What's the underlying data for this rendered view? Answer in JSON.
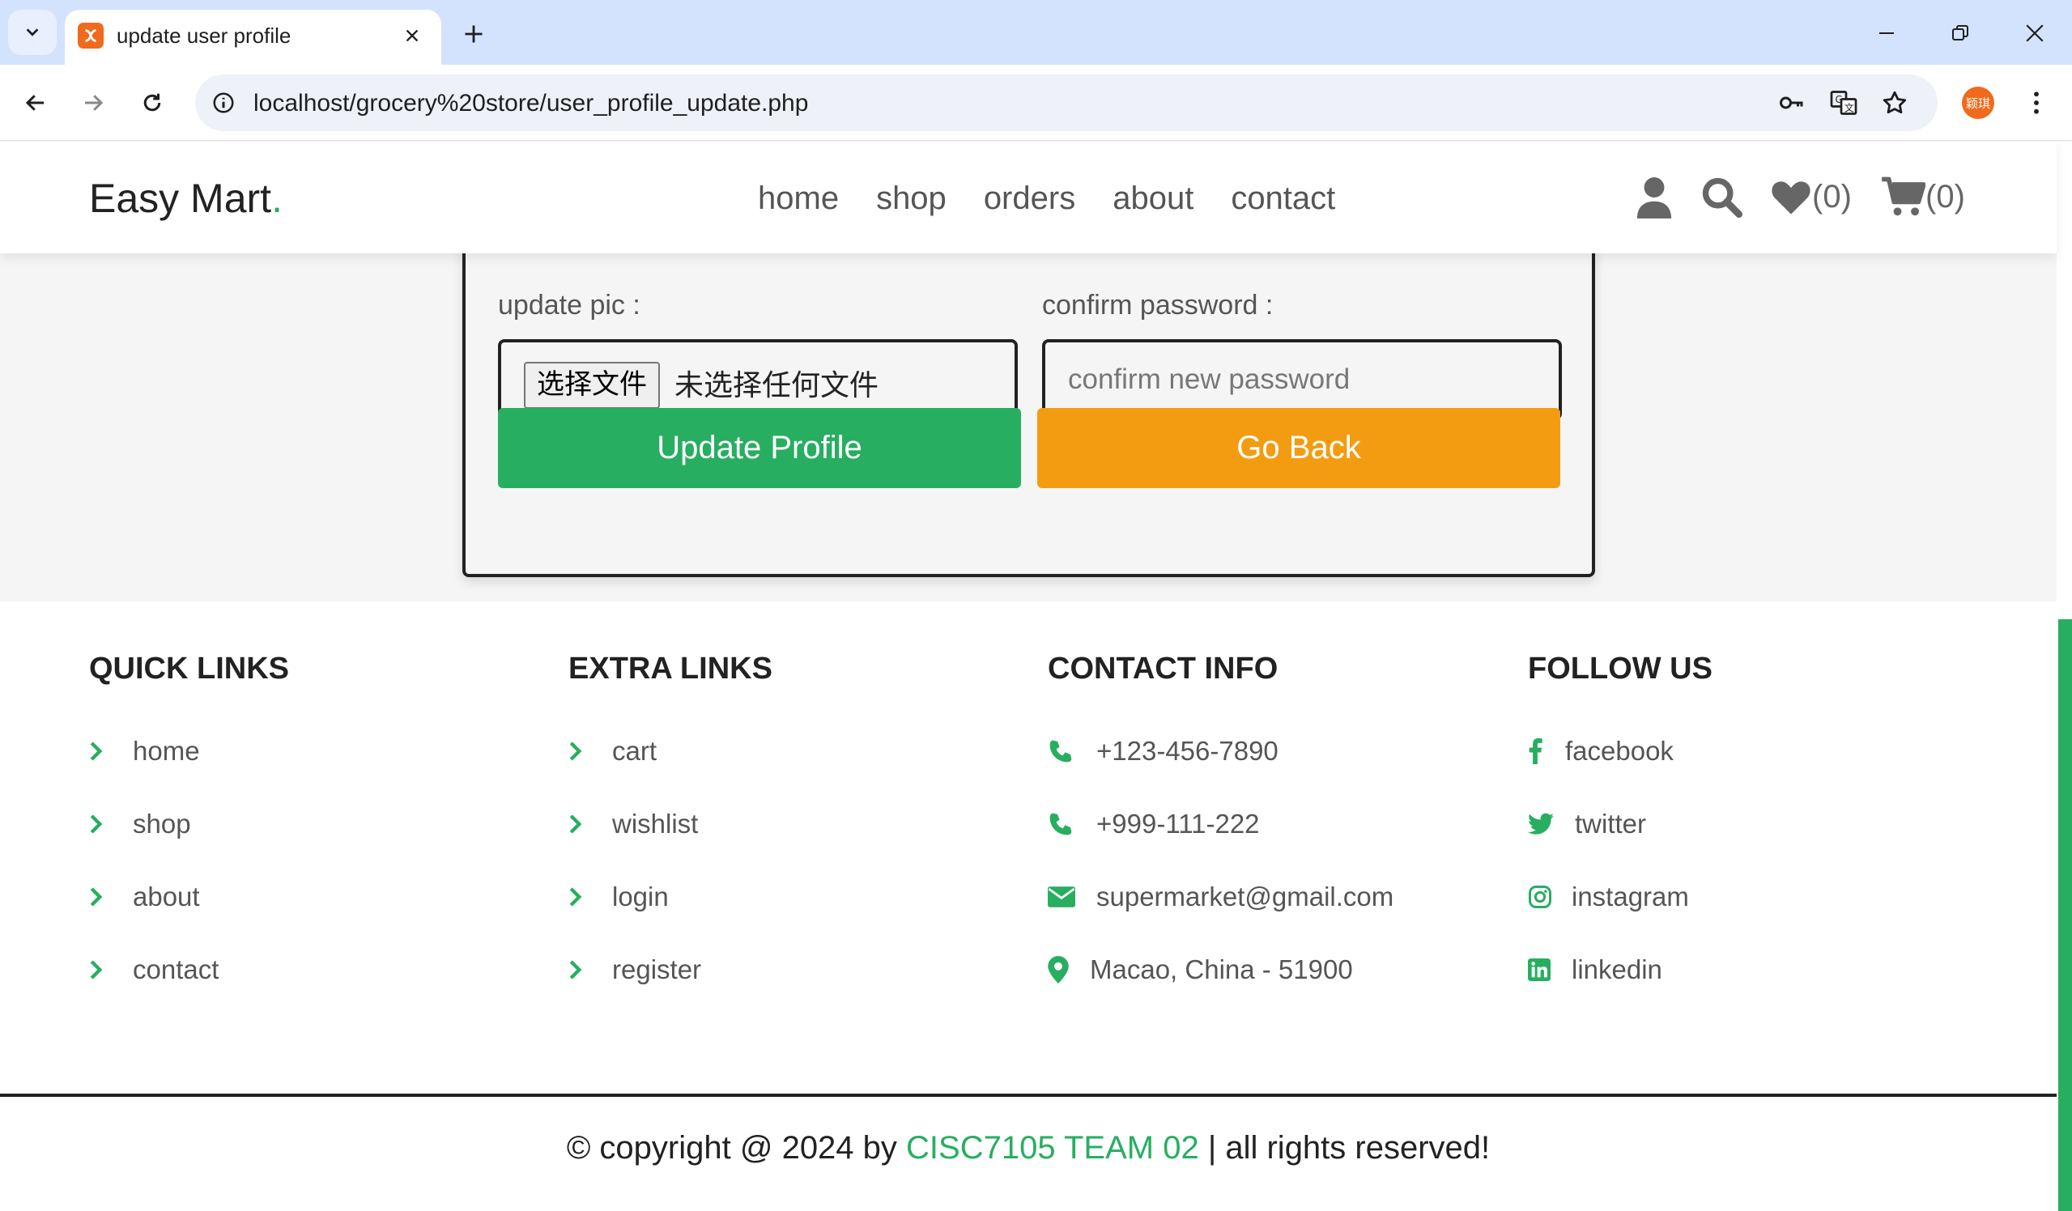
{
  "browser": {
    "tab_title": "update user profile",
    "url": "localhost/grocery%20store/user_profile_update.php",
    "avatar_text": "颖琪"
  },
  "header": {
    "logo": "Easy Mart",
    "logo_dot": ".",
    "nav": [
      "home",
      "shop",
      "orders",
      "about",
      "contact"
    ],
    "wishlist_count": "(0)",
    "cart_count": "(0)"
  },
  "form": {
    "update_pic_label": "update pic :",
    "file_button": "选择文件",
    "file_status": "未选择任何文件",
    "confirm_password_label": "confirm password :",
    "confirm_password_placeholder": "confirm new password",
    "update_button": "Update Profile",
    "back_button": "Go Back"
  },
  "footer": {
    "quick_links": {
      "title": "QUICK LINKS",
      "items": [
        "home",
        "shop",
        "about",
        "contact"
      ]
    },
    "extra_links": {
      "title": "EXTRA LINKS",
      "items": [
        "cart",
        "wishlist",
        "login",
        "register"
      ]
    },
    "contact_info": {
      "title": "CONTACT INFO",
      "phone1": "+123-456-7890",
      "phone2": "+999-111-222",
      "email": "supermarket@gmail.com",
      "address": "Macao, China - 51900"
    },
    "follow_us": {
      "title": "FOLLOW US",
      "items": [
        "facebook",
        "twitter",
        "instagram",
        "linkedin"
      ]
    },
    "credit_prefix": "© copyright @ 2024 by",
    "credit_brand": "CISC7105 TEAM 02",
    "credit_suffix": "| all rights reserved!"
  },
  "colors": {
    "accent": "#27ae60",
    "orange": "#f39c12",
    "dark": "#222222"
  }
}
